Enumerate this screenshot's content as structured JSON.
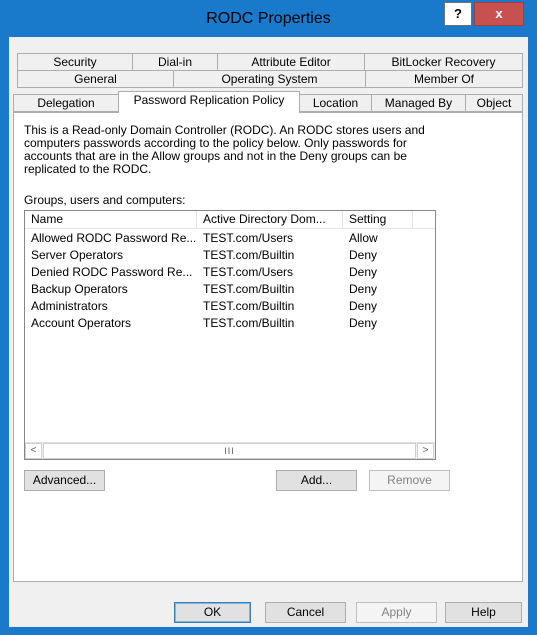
{
  "window": {
    "title": "RODC Properties",
    "help_glyph": "?",
    "close_glyph": "x"
  },
  "tabs": {
    "row1": [
      "Security",
      "Dial-in",
      "Attribute Editor",
      "BitLocker Recovery"
    ],
    "row2": [
      "General",
      "Operating System",
      "Member Of"
    ],
    "row3": [
      "Delegation",
      "Password Replication Policy",
      "Location",
      "Managed By",
      "Object"
    ],
    "active": "Password Replication Policy"
  },
  "panel": {
    "intro_lines": [
      "This is a Read-only Domain Controller (RODC).  An RODC stores users and",
      "computers passwords according to the policy below.  Only passwords for",
      "accounts that are in the Allow groups and not in the Deny groups can be",
      "replicated to the RODC."
    ],
    "groups_label": "Groups, users and computers:",
    "columns": [
      "Name",
      "Active Directory Dom...",
      "Setting"
    ],
    "rows": [
      [
        "Allowed RODC Password Re...",
        "TEST.com/Users",
        "Allow"
      ],
      [
        "Server Operators",
        "TEST.com/Builtin",
        "Deny"
      ],
      [
        "Denied RODC Password Re...",
        "TEST.com/Users",
        "Deny"
      ],
      [
        "Backup Operators",
        "TEST.com/Builtin",
        "Deny"
      ],
      [
        "Administrators",
        "TEST.com/Builtin",
        "Deny"
      ],
      [
        "Account Operators",
        "TEST.com/Builtin",
        "Deny"
      ]
    ],
    "scroll_left": "<",
    "scroll_right": ">",
    "scroll_thumb": "III",
    "advanced_label": "Advanced...",
    "add_label": "Add...",
    "remove_label": "Remove"
  },
  "footer": {
    "ok_label": "OK",
    "cancel_label": "Cancel",
    "apply_label": "Apply",
    "help_label": "Help"
  },
  "colors": {
    "title_bar": "#1979ca",
    "close_button": "#c75050",
    "dialog_bg": "#f0f0f0"
  }
}
